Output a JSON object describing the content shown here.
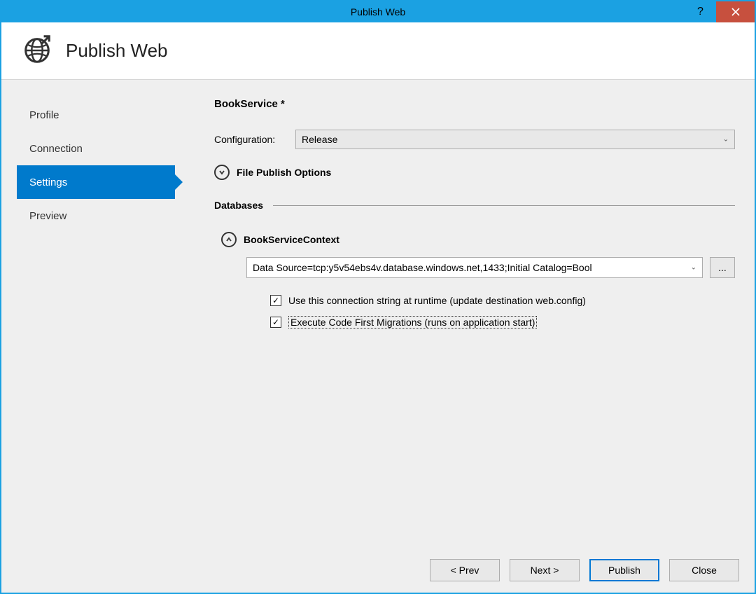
{
  "window": {
    "title": "Publish Web"
  },
  "header": {
    "title": "Publish Web"
  },
  "sidebar": {
    "items": [
      {
        "label": "Profile",
        "active": false
      },
      {
        "label": "Connection",
        "active": false
      },
      {
        "label": "Settings",
        "active": true
      },
      {
        "label": "Preview",
        "active": false
      }
    ]
  },
  "main": {
    "profile_name": "BookService *",
    "config_label": "Configuration:",
    "config_value": "Release",
    "file_publish_label": "File Publish Options",
    "databases_label": "Databases",
    "db_context_label": "BookServiceContext",
    "connection_string": "Data Source=tcp:y5v54ebs4v.database.windows.net,1433;Initial Catalog=Bool",
    "ellipsis": "...",
    "check1_label": "Use this connection string at runtime (update destination web.config)",
    "check2_label": "Execute Code First Migrations (runs on application start)"
  },
  "footer": {
    "prev": "< Prev",
    "next": "Next >",
    "publish": "Publish",
    "close": "Close"
  }
}
